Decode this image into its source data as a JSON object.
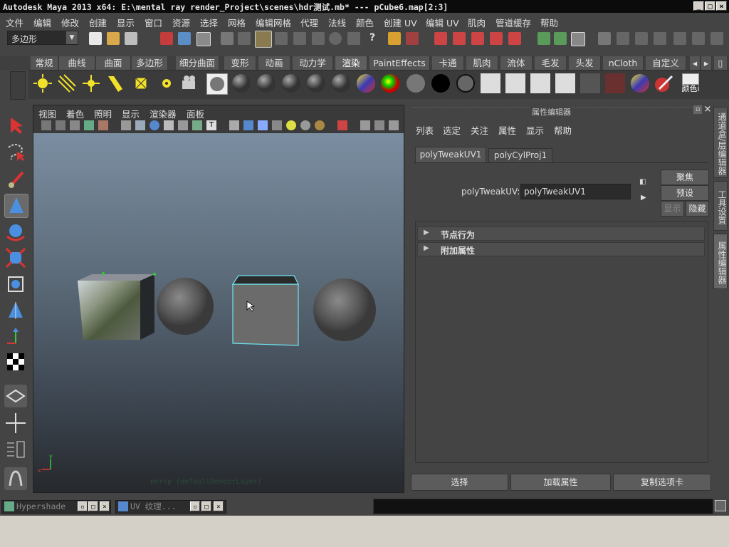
{
  "window": {
    "title": "Autodesk Maya 2013 x64: E:\\mental ray render_Project\\scenes\\hdr测试.mb*   ---   pCube6.map[2:3]"
  },
  "menubar": [
    "文件",
    "编辑",
    "修改",
    "创建",
    "显示",
    "窗口",
    "资源",
    "选择",
    "网格",
    "编辑网格",
    "代理",
    "法线",
    "颜色",
    "创建 UV",
    "编辑 UV",
    "肌肉",
    "管道缓存",
    "帮助"
  ],
  "statusline": {
    "menu_set": "多边形"
  },
  "shelf": {
    "tabs": [
      "常规",
      "曲线",
      "曲面",
      "多边形",
      "细分曲面",
      "变形",
      "动画",
      "动力学",
      "渲染",
      "PaintEffects",
      "卡通",
      "肌肉",
      "流体",
      "毛发",
      "头发",
      "nCloth",
      "自定义"
    ],
    "active_tab": "渲染",
    "last_icon_label": "颜色i"
  },
  "viewport": {
    "menus": [
      "视图",
      "着色",
      "照明",
      "显示",
      "渲染器",
      "面板"
    ],
    "camera_label": "persp (defaultRenderLayer)",
    "axis_y": "y",
    "axis_x": "x"
  },
  "attribute_editor": {
    "title": "属性编辑器",
    "menus": [
      "列表",
      "选定",
      "关注",
      "属性",
      "显示",
      "帮助"
    ],
    "tabs": [
      "polyTweakUV1",
      "polyCylProj1"
    ],
    "active_tab": "polyTweakUV1",
    "node_label": "polyTweakUV:",
    "node_value": "polyTweakUV1",
    "buttons": {
      "focus": "聚焦",
      "presets": "预设",
      "show": "显示",
      "hide": "隐藏"
    },
    "sections": [
      "节点行为",
      "附加属性"
    ],
    "bottom_buttons": [
      "选择",
      "加载属性",
      "复制选项卡"
    ]
  },
  "side_tabs": [
    "通道盒/层编辑器",
    "工具设置",
    "属性编辑器"
  ],
  "taskbar": {
    "items": [
      "Hypershade",
      "UV 纹理..."
    ]
  },
  "colors": {
    "background": "#444444",
    "selection_cyan": "#6fe3f0",
    "active_tool": "#6a6a6a"
  }
}
